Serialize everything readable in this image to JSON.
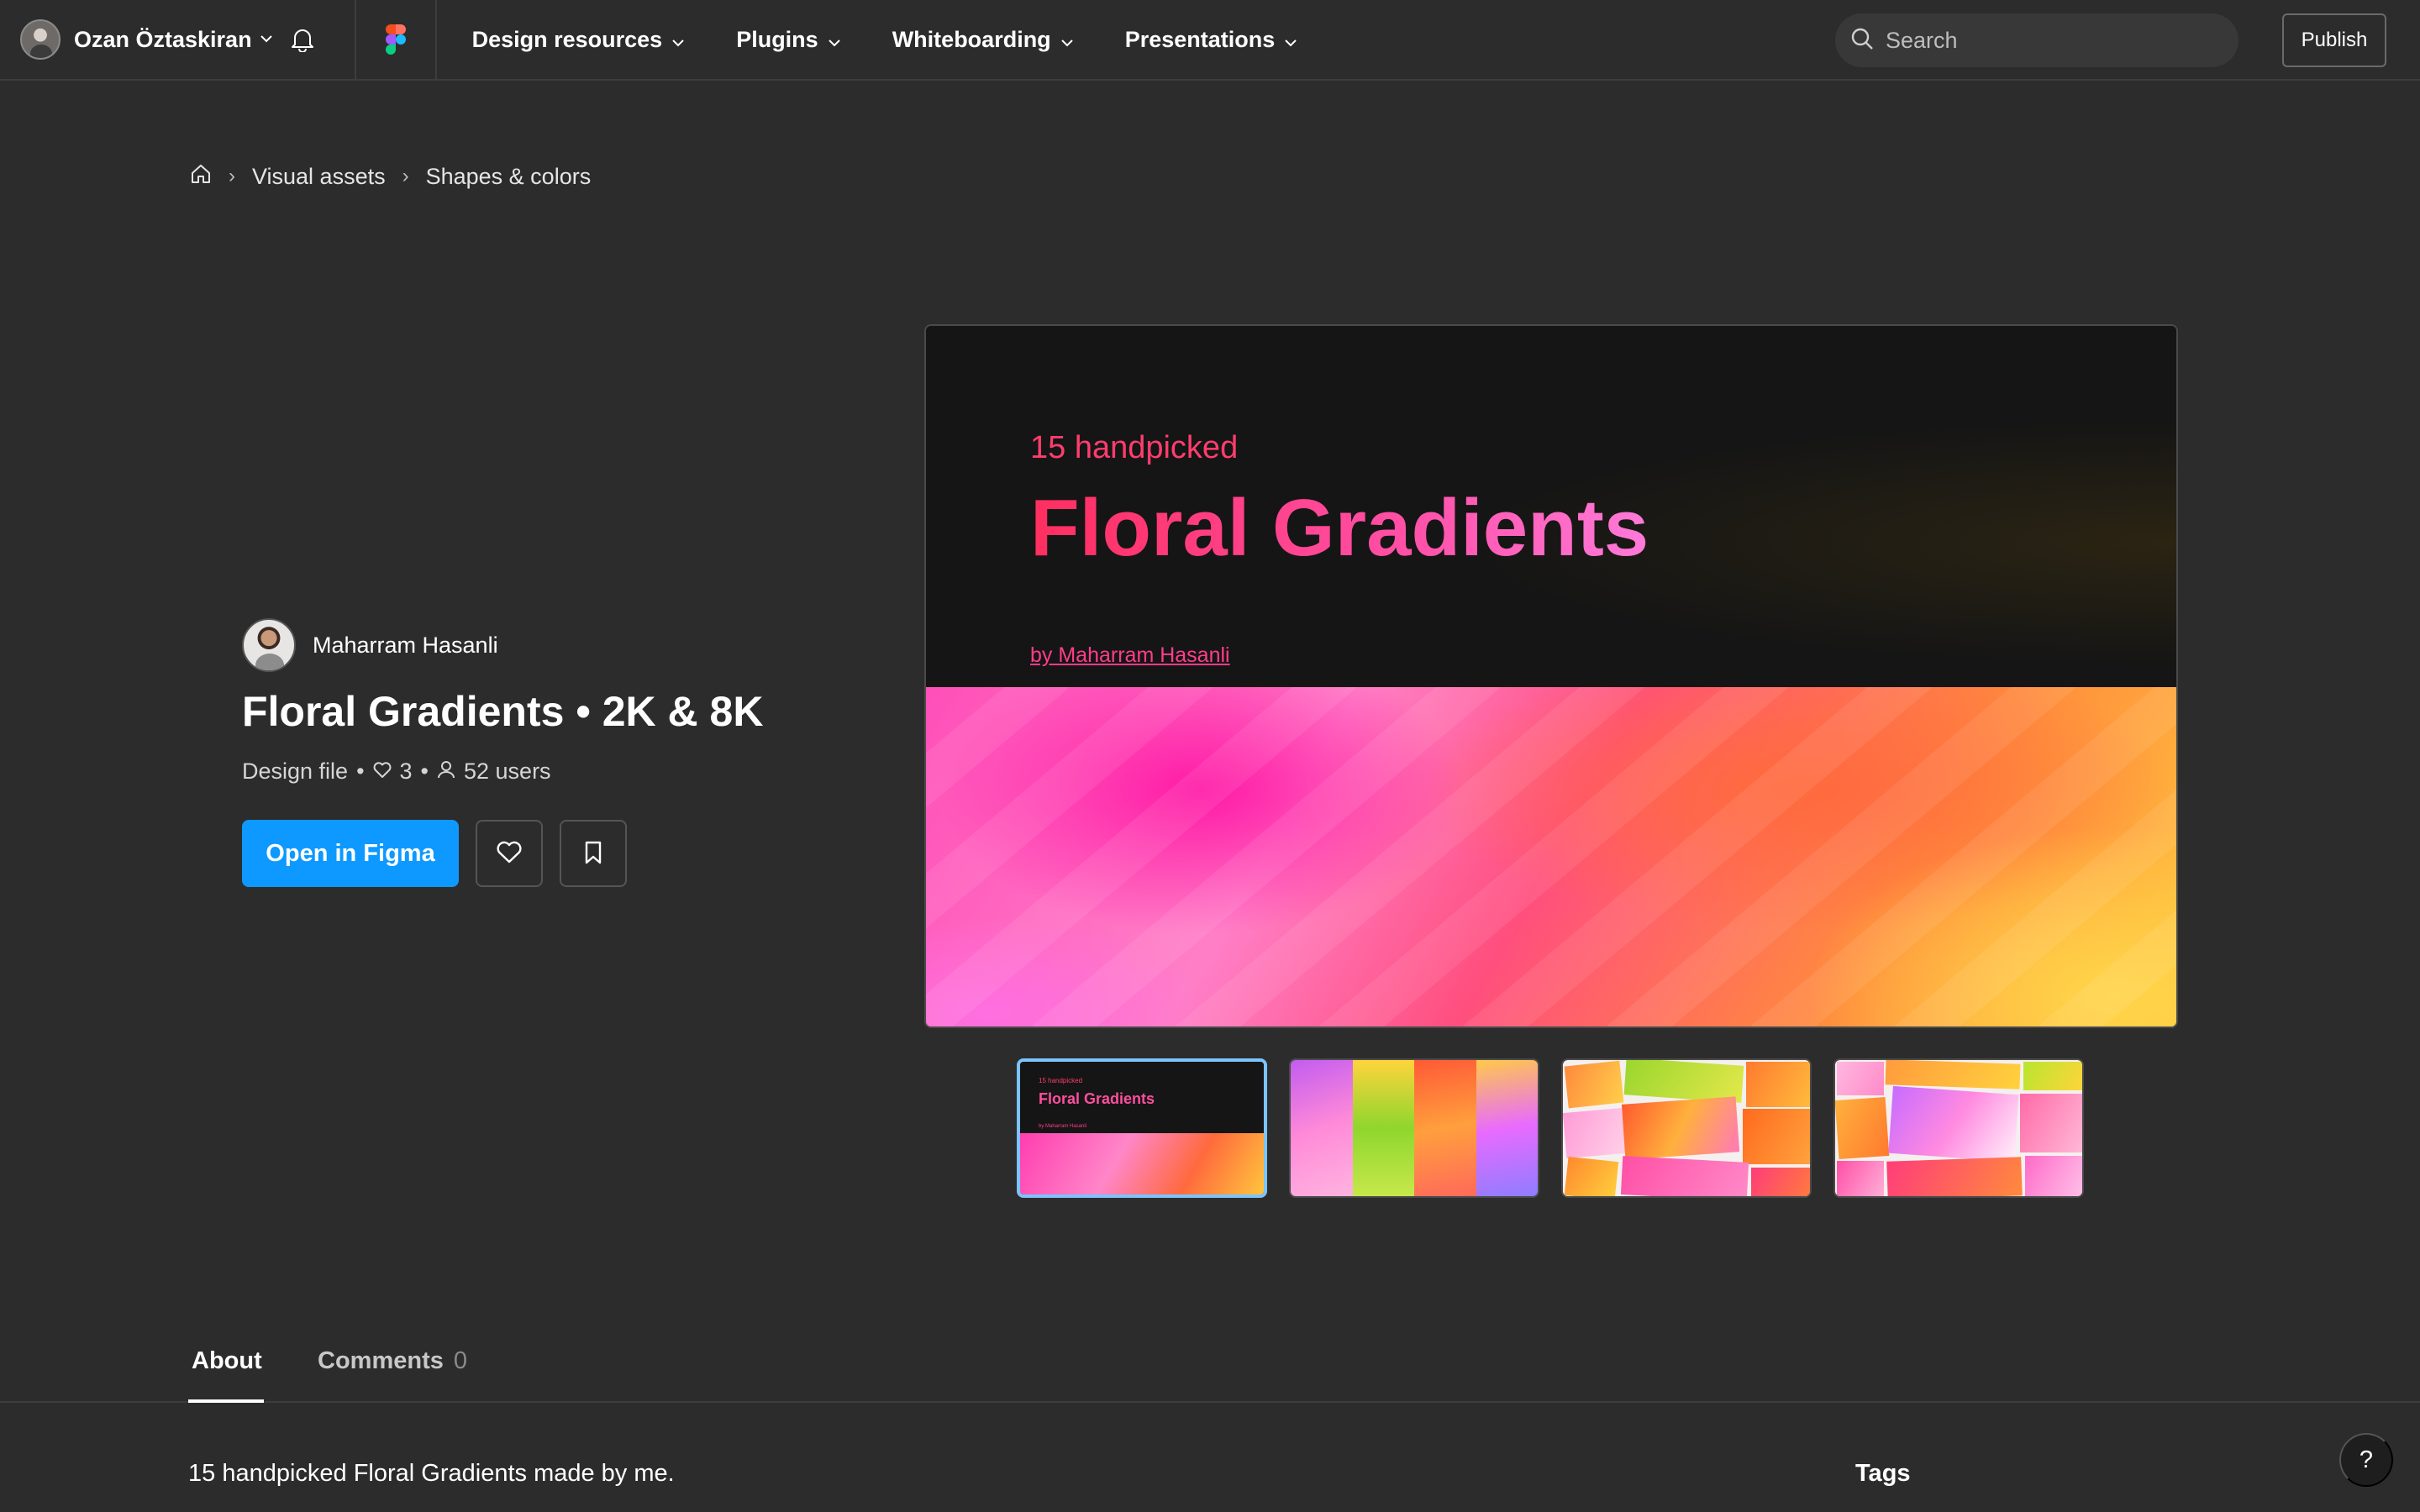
{
  "topbar": {
    "user_name": "Ozan Öztaskiran",
    "nav": [
      {
        "label": "Design resources"
      },
      {
        "label": "Plugins"
      },
      {
        "label": "Whiteboarding"
      },
      {
        "label": "Presentations"
      }
    ],
    "search_placeholder": "Search",
    "publish_label": "Publish"
  },
  "breadcrumb": {
    "items": [
      "Visual assets",
      "Shapes & colors"
    ]
  },
  "resource": {
    "author": "Maharram Hasanli",
    "title": "Floral Gradients • 2K & 8K",
    "type": "Design file",
    "likes": "3",
    "users": "52 users",
    "open_label": "Open in Figma"
  },
  "preview": {
    "subtitle": "15 handpicked",
    "title": "Floral Gradients",
    "byline": "by Maharram Hasanli",
    "thumb_title": "Floral Gradients",
    "thumb_subtitle": "15 handpicked",
    "thumb_byline": "by Maharram Hasanli"
  },
  "tabs": {
    "about": "About",
    "comments": "Comments",
    "comments_count": "0"
  },
  "about": {
    "description": "15 handpicked Floral Gradients made by me.",
    "tags_title": "Tags"
  },
  "help_label": "?",
  "colors": {
    "accent": "#0d99ff",
    "background": "#2c2c2c",
    "preview_pink": "#ff3d6e"
  }
}
